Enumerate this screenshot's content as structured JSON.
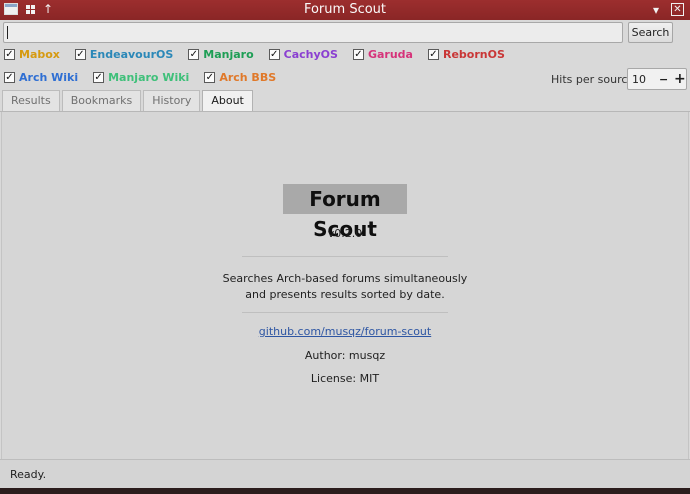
{
  "window": {
    "title": "Forum Scout",
    "close_glyph": "✕",
    "menu_glyph": "▾",
    "pin_glyph": "↑"
  },
  "search": {
    "value": "",
    "placeholder": "",
    "button_label": "Search"
  },
  "sources_row1": [
    {
      "label": "Mabox",
      "checked": true,
      "color": "#d69a10"
    },
    {
      "label": "EndeavourOS",
      "checked": true,
      "color": "#2b88b8"
    },
    {
      "label": "Manjaro",
      "checked": true,
      "color": "#1e9e55"
    },
    {
      "label": "CachyOS",
      "checked": true,
      "color": "#8a3fd1"
    },
    {
      "label": "Garuda",
      "checked": true,
      "color": "#d6337a"
    },
    {
      "label": "RebornOS",
      "checked": true,
      "color": "#c93636"
    }
  ],
  "sources_row2": [
    {
      "label": "Arch Wiki",
      "checked": true,
      "color": "#2f6fd3"
    },
    {
      "label": "Manjaro Wiki",
      "checked": true,
      "color": "#3fc07a"
    },
    {
      "label": "Arch BBS",
      "checked": true,
      "color": "#e0792a"
    }
  ],
  "check_glyph": "✓",
  "hits": {
    "label": "Hits per source:",
    "value": "10",
    "minus": "−",
    "plus": "+"
  },
  "tabs": [
    {
      "label": "Results",
      "active": false
    },
    {
      "label": "Bookmarks",
      "active": false
    },
    {
      "label": "History",
      "active": false
    },
    {
      "label": "About",
      "active": true
    }
  ],
  "about": {
    "name": "Forum Scout",
    "version": "v0.2.0",
    "description_line1": "Searches Arch-based forums simultaneously",
    "description_line2": "and presents results sorted by date.",
    "link": "github.com/musqz/forum-scout",
    "author": "Author: musqz",
    "license": "License: MIT"
  },
  "status": {
    "text": "Ready."
  }
}
